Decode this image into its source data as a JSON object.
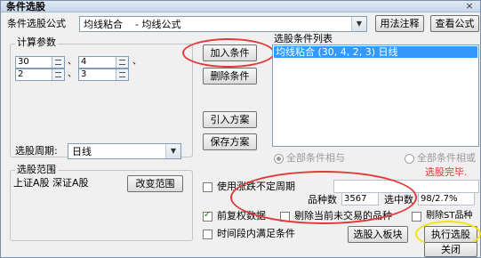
{
  "window": {
    "title": "条件选股",
    "close": "×"
  },
  "formula": {
    "label": "条件选股公式",
    "value": "均线粘合    - 均线公式",
    "usage_btn": "用法注释",
    "view_btn": "查看公式"
  },
  "params": {
    "title": "计算参数",
    "rows": [
      {
        "a": "30",
        "b": "4",
        "sep": "、"
      },
      {
        "a": "2",
        "b": "3",
        "sep": "、"
      }
    ]
  },
  "buttons": {
    "add": "加入条件",
    "delete": "删除条件",
    "import": "引入方案",
    "save": "保存方案",
    "change_range": "改变范围",
    "to_sector": "选股入板块",
    "execute": "执行选股",
    "close": "关闭"
  },
  "conditions": {
    "title": "选股条件列表",
    "selected": "均线粘合 (30, 4, 2, 3) 日线"
  },
  "period": {
    "label": "选股周期:",
    "value": "日线"
  },
  "range": {
    "title": "选股范围",
    "value": "上证A股 深证A股"
  },
  "logic": {
    "all_and": "全部条件相与",
    "all_or": "全部条件相或"
  },
  "status": {
    "done": "选股完毕."
  },
  "options": {
    "variable_period": "使用涨跌不定周期",
    "prev_rights": "前复权数据",
    "exclude_untraded": "剔除当前未交易的品种",
    "exclude_st": "剔除ST品种",
    "time_range": "时间段内满足条件"
  },
  "stats": {
    "count_label": "品种数",
    "count_value": "3567",
    "hits_label": "选中数",
    "hits_value": "98/2.7%"
  }
}
